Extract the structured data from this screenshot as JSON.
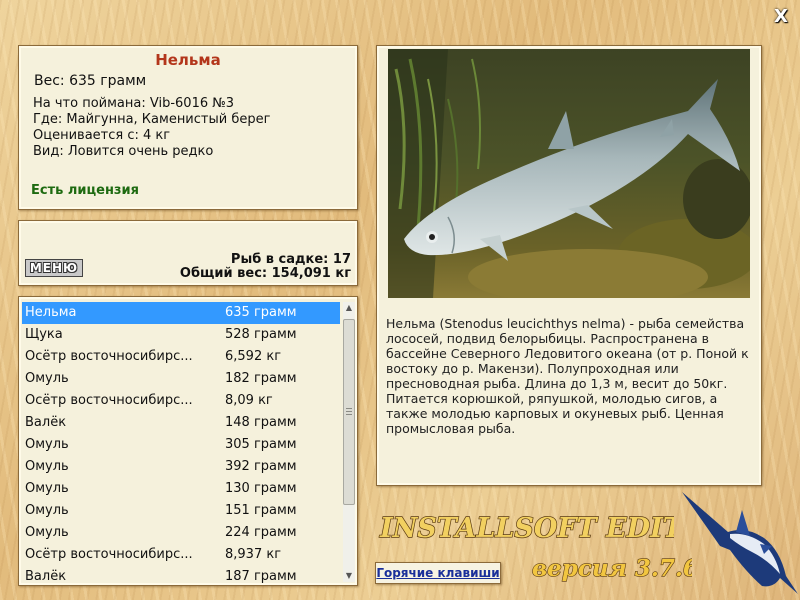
{
  "window": {
    "close_glyph": "X"
  },
  "fish": {
    "name": "Нельма",
    "weight": "Вес: 635 грамм",
    "caught_with": "На что поймана: Vib-6016 №3",
    "caught_where": "Где: Майгунна, Каменистый берег",
    "price": "Оценивается с: 4 кг",
    "kind": "Вид: Ловится очень редко",
    "license": "Есть лицензия"
  },
  "stats": {
    "menu_label": "МЕНЮ",
    "fish_in_cage": "Рыб в садке: 17",
    "total_weight": "Общий вес: 154,091 кг"
  },
  "catch_list": [
    {
      "name": "Нельма",
      "weight": "635 грамм"
    },
    {
      "name": "Щука",
      "weight": "528 грамм"
    },
    {
      "name": "Осётр восточносибирс...",
      "weight": "6,592 кг"
    },
    {
      "name": "Омуль",
      "weight": "182 грамм"
    },
    {
      "name": "Осётр восточносибирс...",
      "weight": "8,09 кг"
    },
    {
      "name": "Валёк",
      "weight": "148 грамм"
    },
    {
      "name": "Омуль",
      "weight": "305 грамм"
    },
    {
      "name": "Омуль",
      "weight": "392 грамм"
    },
    {
      "name": "Омуль",
      "weight": "130 грамм"
    },
    {
      "name": "Омуль",
      "weight": "151 грамм"
    },
    {
      "name": "Омуль",
      "weight": "224 грамм"
    },
    {
      "name": "Осётр восточносибирс...",
      "weight": "8,937 кг"
    },
    {
      "name": "Валёк",
      "weight": "187 грамм"
    }
  ],
  "description": "Нельма (Stenodus leucichthys nelma) - рыба семейства лососей, подвид белорыбицы. Распространена в бассейне Северного Ледовитого океана (от р. Поной к востоку до р. Макензи). Полупроходная или пресноводная рыба. Длина до 1,3 м, весит до 50кг. Питается корюшкой, ряпушкой, молодью сигов, а также молодью карповых и окуневых рыб. Ценная промысловая рыба.",
  "footer": {
    "hotkeys_label": "Горячие клавиши",
    "edition": "INSTALLSOFT EDITION",
    "version": "версия 3.7.6"
  },
  "colors": {
    "selected_row": "#3399ff",
    "fish_name": "#b3361b",
    "license": "#1d6a10",
    "link": "#1a2f9a"
  }
}
